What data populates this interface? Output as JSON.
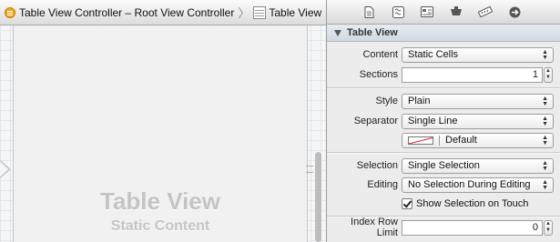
{
  "jumpbar": {
    "scene_label": "Table View Controller – Root View Controller",
    "object_label": "Table View"
  },
  "canvas": {
    "scene_title": "Table View",
    "scene_subtitle": "Static Content"
  },
  "inspector": {
    "tab_icons": [
      "file-icon",
      "quick-help-icon",
      "identity-icon",
      "attributes-icon",
      "size-icon",
      "connections-icon"
    ],
    "section_title": "Table View",
    "content": {
      "label": "Content",
      "value": "Static Cells"
    },
    "sections": {
      "label": "Sections",
      "value": "1"
    },
    "style": {
      "label": "Style",
      "value": "Plain"
    },
    "separator": {
      "label": "Separator",
      "value": "Single Line",
      "color_value": "Default"
    },
    "selection": {
      "label": "Selection",
      "value": "Single Selection"
    },
    "editing": {
      "label": "Editing",
      "value": "No Selection During Editing"
    },
    "show_selection": {
      "label": "Show Selection on Touch",
      "checked": true
    },
    "index_row_limit": {
      "label": "Index Row Limit",
      "value": "0"
    }
  },
  "colors": {
    "separator_swatch": "#d8202a",
    "section_header": "#d2d8e1"
  }
}
